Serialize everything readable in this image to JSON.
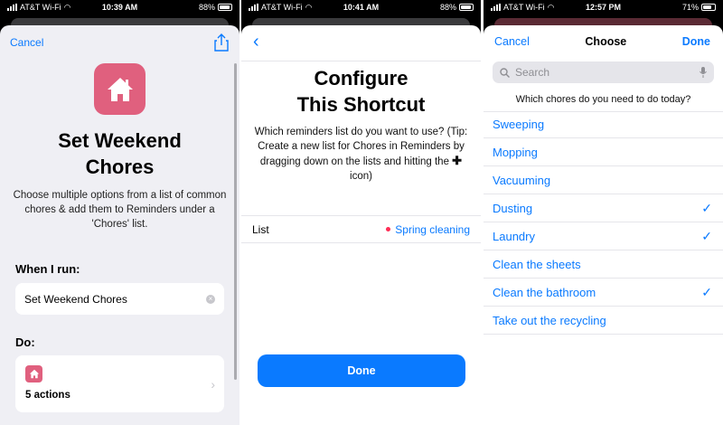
{
  "phone1": {
    "status": {
      "carrier": "AT&T Wi-Fi",
      "time": "10:39 AM",
      "battery": "88%",
      "battery_level": 0.88
    },
    "cancel": "Cancel",
    "title": "Set Weekend\nChores",
    "description": "Choose multiple options from a list of common chores & add them to Reminders under a 'Chores' list.",
    "when_label": "When I run:",
    "phrase_value": "Set Weekend Chores",
    "do_label": "Do:",
    "actions_label": "5 actions",
    "icons": {
      "share": "share-icon",
      "app": "house-icon",
      "clear": "clear-icon",
      "chevron": "chevron-right-icon"
    },
    "colors": {
      "app_icon": "#e0607e",
      "accent": "#0a7aff",
      "sheet_bg": "#efeff4"
    }
  },
  "phone2": {
    "status": {
      "carrier": "AT&T Wi-Fi",
      "time": "10:41 AM",
      "battery": "88%",
      "battery_level": 0.88
    },
    "title": "Configure\nThis Shortcut",
    "description_part1": "Which reminders list do you want to use? (Tip: Create a new list for Chores in Reminders by dragging down on the lists and hitting the",
    "description_part2": "icon)",
    "list_label": "List",
    "list_value": "Spring cleaning",
    "done": "Done",
    "icons": {
      "back": "chevron-left-icon",
      "plus": "plus-icon",
      "list_dot": "red-dot-icon"
    },
    "colors": {
      "list_dot": "#ff2d55",
      "button": "#0a7aff"
    }
  },
  "phone3": {
    "status": {
      "carrier": "AT&T Wi-Fi",
      "time": "12:57 PM",
      "battery": "71%",
      "battery_level": 0.71
    },
    "cancel": "Cancel",
    "title": "Choose",
    "done": "Done",
    "search_placeholder": "Search",
    "prompt": "Which chores do you need to do today?",
    "options": [
      {
        "label": "Sweeping",
        "checked": false
      },
      {
        "label": "Mopping",
        "checked": false
      },
      {
        "label": "Vacuuming",
        "checked": false
      },
      {
        "label": "Dusting",
        "checked": true
      },
      {
        "label": "Laundry",
        "checked": true
      },
      {
        "label": "Clean the sheets",
        "checked": false
      },
      {
        "label": "Clean the bathroom",
        "checked": true
      },
      {
        "label": "Take out the recycling",
        "checked": false
      }
    ],
    "check_glyph": "✓",
    "icons": {
      "search": "magnifier-icon",
      "mic": "microphone-icon",
      "check": "checkmark-icon"
    }
  }
}
